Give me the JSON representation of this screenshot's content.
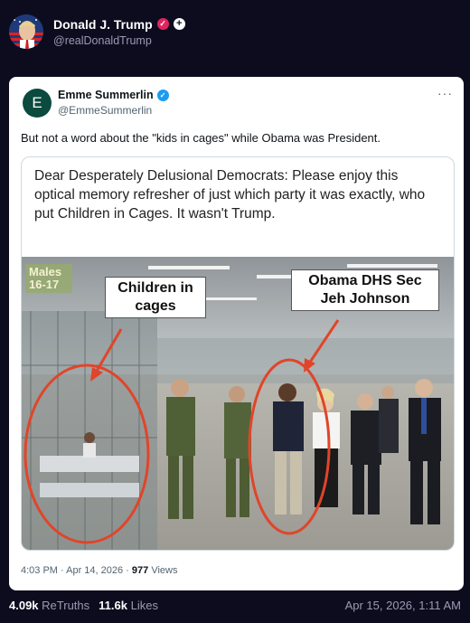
{
  "post": {
    "display_name": "Donald J. Trump",
    "handle": "@realDonaldTrump",
    "avatar_icon": "flag-portrait-avatar",
    "badge_verified": "✓",
    "badge_plus": "+"
  },
  "quoted_tweet": {
    "avatar_letter": "E",
    "display_name": "Emme Summerlin",
    "handle": "@EmmeSummerlin",
    "more": "···",
    "text": "But not a word about the \"kids in cages\" while Obama was President.",
    "media": {
      "caption": "Dear Desperately Delusional Democrats: Please enjoy this optical memory refresher of just which party it was exactly, who put Children in Cages. It wasn't Trump.",
      "label_left": "Children in cages",
      "label_right": "Obama DHS Sec Jeh Johnson",
      "sign": "Males 16-17"
    },
    "time": "4:03 PM · Apr 14, 2026 ·",
    "views_count": "977",
    "views_label": "Views"
  },
  "stats": {
    "retruths_count": "4.09k",
    "retruths_label": "ReTruths",
    "likes_count": "11.6k",
    "likes_label": "Likes",
    "date": "Apr 15, 2026, 1:11 AM"
  },
  "colors": {
    "background": "#0d0c1f",
    "badge_red": "#e0245e",
    "verified_blue": "#1d9bf0",
    "circle_red": "#e0452a"
  }
}
